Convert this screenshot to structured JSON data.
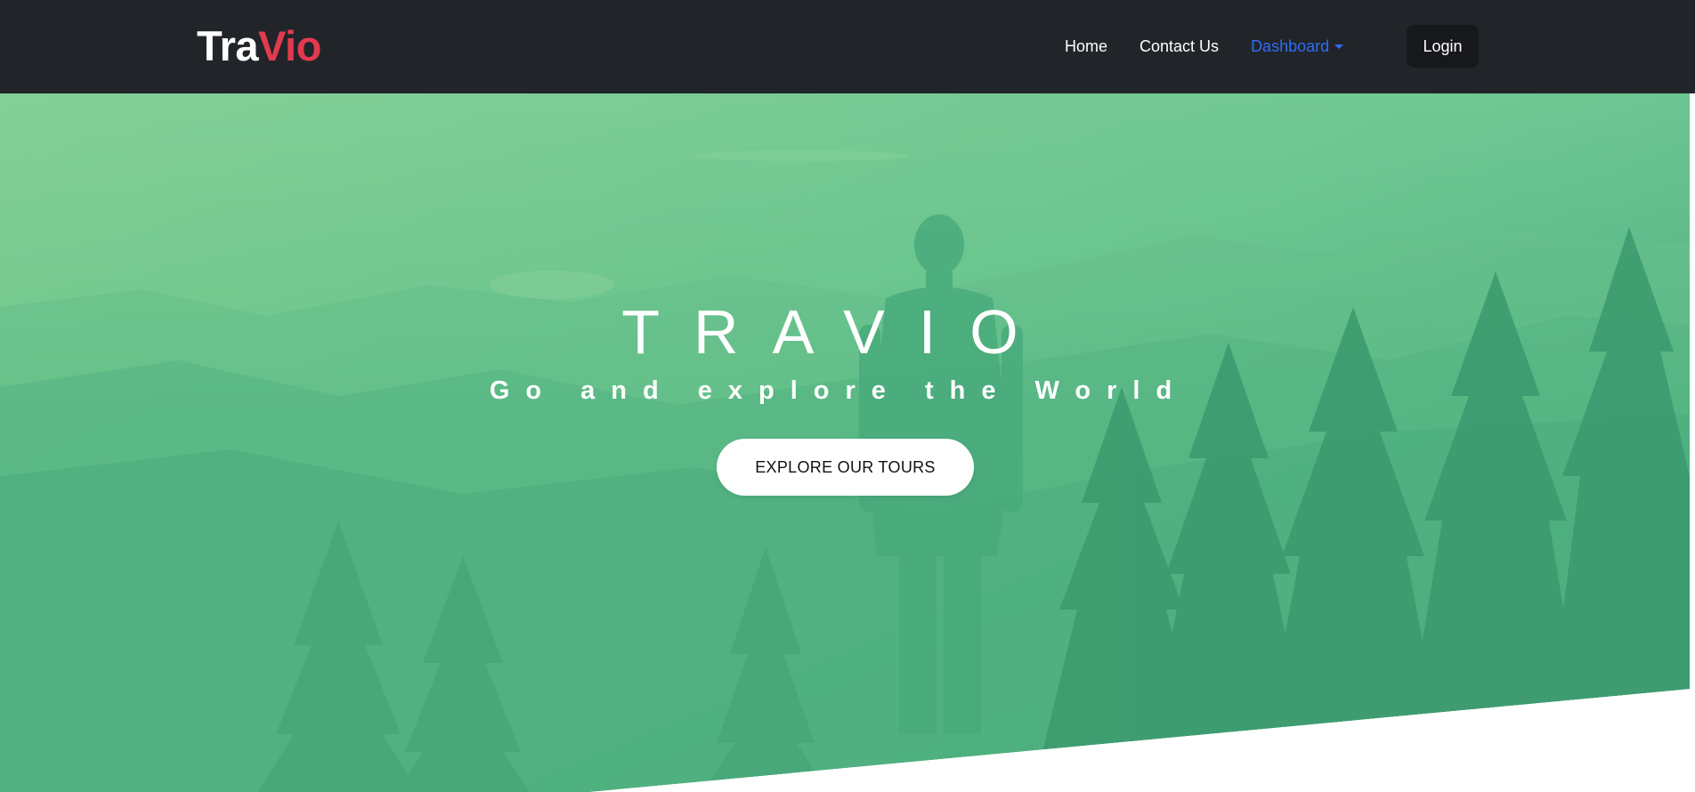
{
  "navbar": {
    "brand": {
      "part1": "Tra",
      "part2": "Vio"
    },
    "links": {
      "home": "Home",
      "contact": "Contact Us",
      "dashboard": "Dashboard"
    },
    "login_label": "Login"
  },
  "hero": {
    "title": "TRAVIO",
    "subtitle": "Go and explore the World",
    "cta_label": "EXPLORE OUR TOURS"
  },
  "colors": {
    "navbar_bg": "#212529",
    "brand_accent": "#e23a4f",
    "active_link": "#2f6cf6",
    "hero_green": "#5bbf87"
  },
  "icons": {
    "dashboard_dropdown": "caret-down-icon"
  }
}
